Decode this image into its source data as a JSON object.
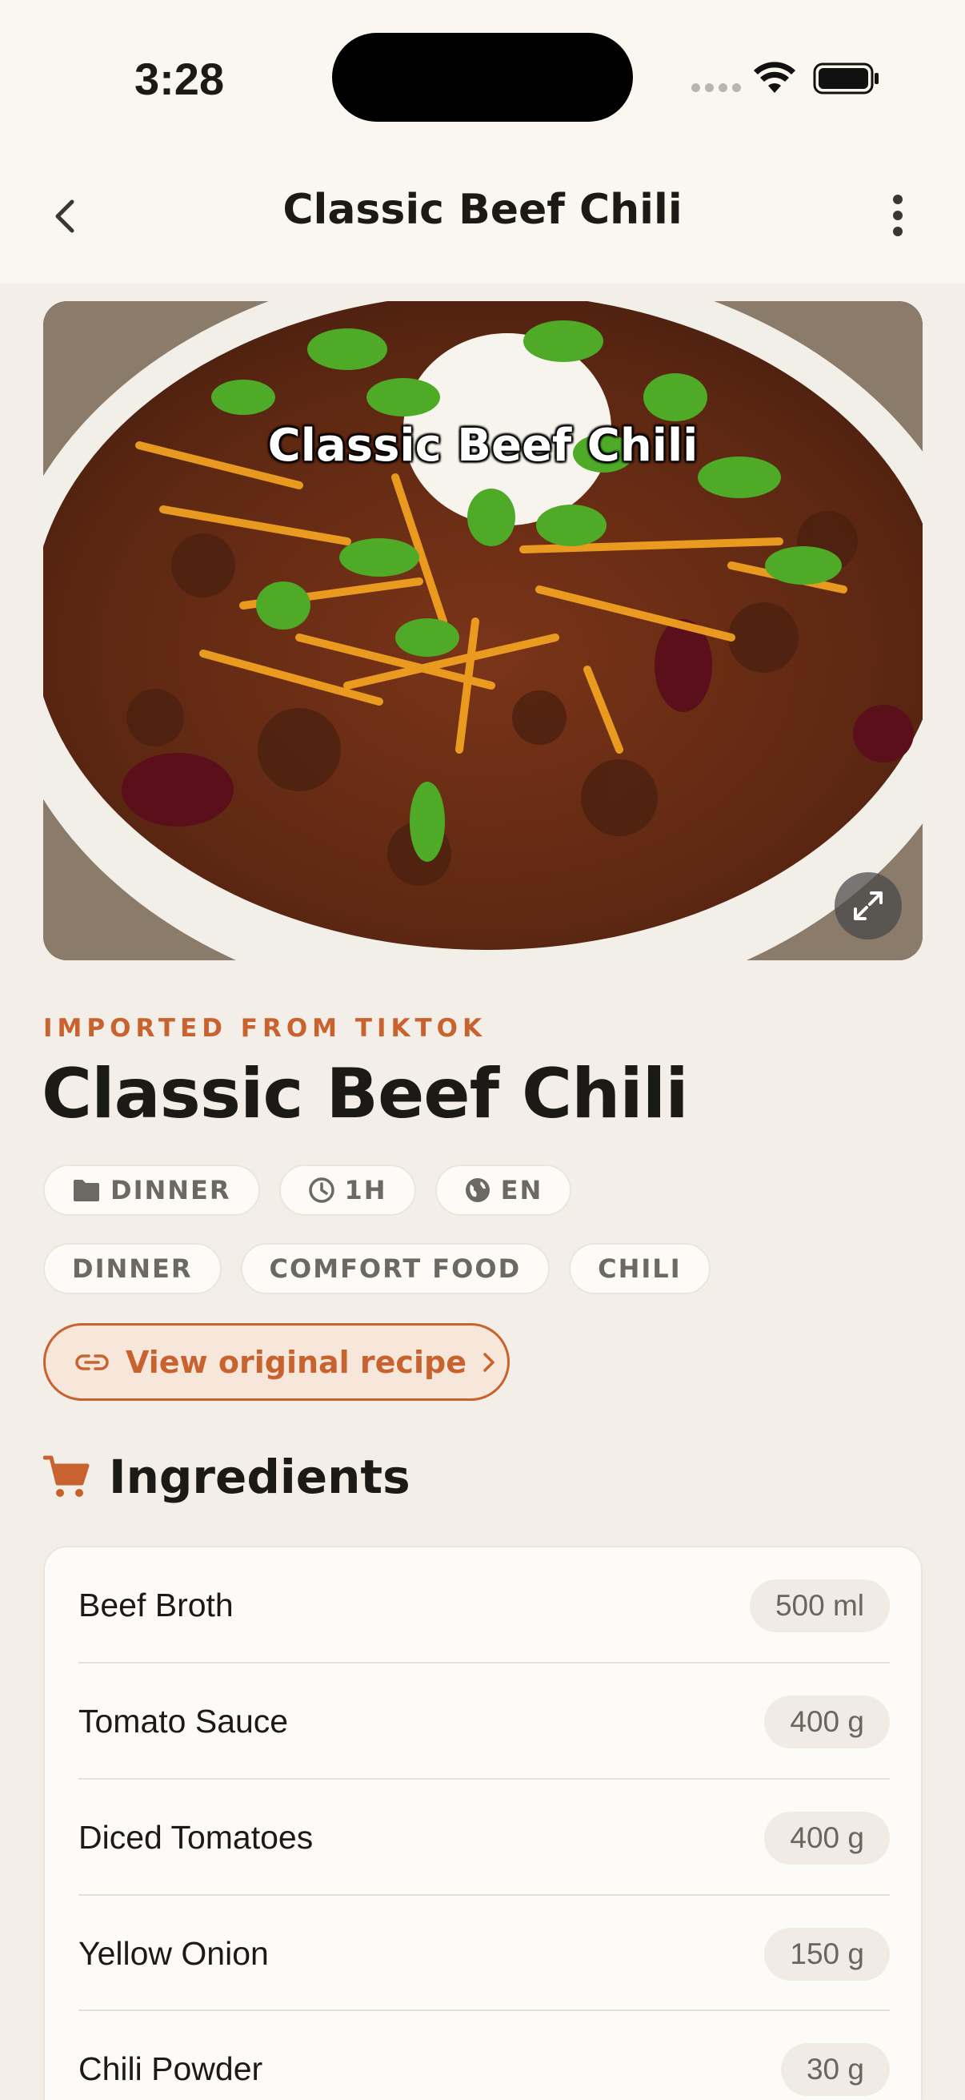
{
  "status_bar": {
    "time": "3:28"
  },
  "nav": {
    "title": "Classic Beef Chili",
    "back_icon": "chevron-left-icon",
    "more_icon": "more-vertical-icon"
  },
  "hero": {
    "caption": "Classic Beef Chili",
    "expand_icon": "expand-icon"
  },
  "recipe": {
    "source": "IMPORTED FROM TIKTOK",
    "title": "Classic Beef Chili",
    "meta_chips": [
      {
        "icon": "folder-icon",
        "label": "DINNER"
      },
      {
        "icon": "clock-icon",
        "label": "1H"
      },
      {
        "icon": "globe-icon",
        "label": "EN"
      }
    ],
    "tags": [
      "DINNER",
      "COMFORT FOOD",
      "CHILI"
    ],
    "view_original": "View original recipe"
  },
  "ingredients": {
    "heading": "Ingredients",
    "icon": "cart-icon",
    "items": [
      {
        "name": "Beef Broth",
        "qty": "500 ml"
      },
      {
        "name": "Tomato Sauce",
        "qty": "400 g"
      },
      {
        "name": "Diced Tomatoes",
        "qty": "400 g"
      },
      {
        "name": "Yellow Onion",
        "qty": "150 g"
      },
      {
        "name": "Chili Powder",
        "qty": "30 g"
      }
    ]
  },
  "colors": {
    "accent": "#c8622f",
    "background": "#f3efe8",
    "header": "#faf7f0"
  }
}
